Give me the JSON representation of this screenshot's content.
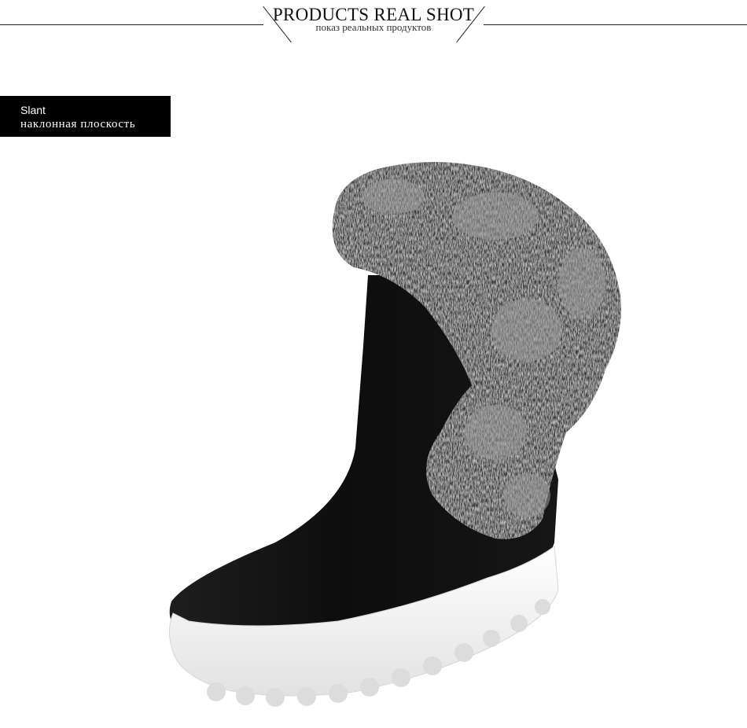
{
  "header": {
    "title": "PRODUCTS REAL SHOT",
    "subtitle": "показ реальных продуктов"
  },
  "label": {
    "en": "Slant",
    "ru": "наклонная плоскость"
  },
  "photo": {
    "subject": "boot-photo",
    "colors": {
      "suede": "#121212",
      "fur_dark": "#3a3a3a",
      "fur_light": "#c9c9c9",
      "sole": "#f4f4f4"
    }
  }
}
